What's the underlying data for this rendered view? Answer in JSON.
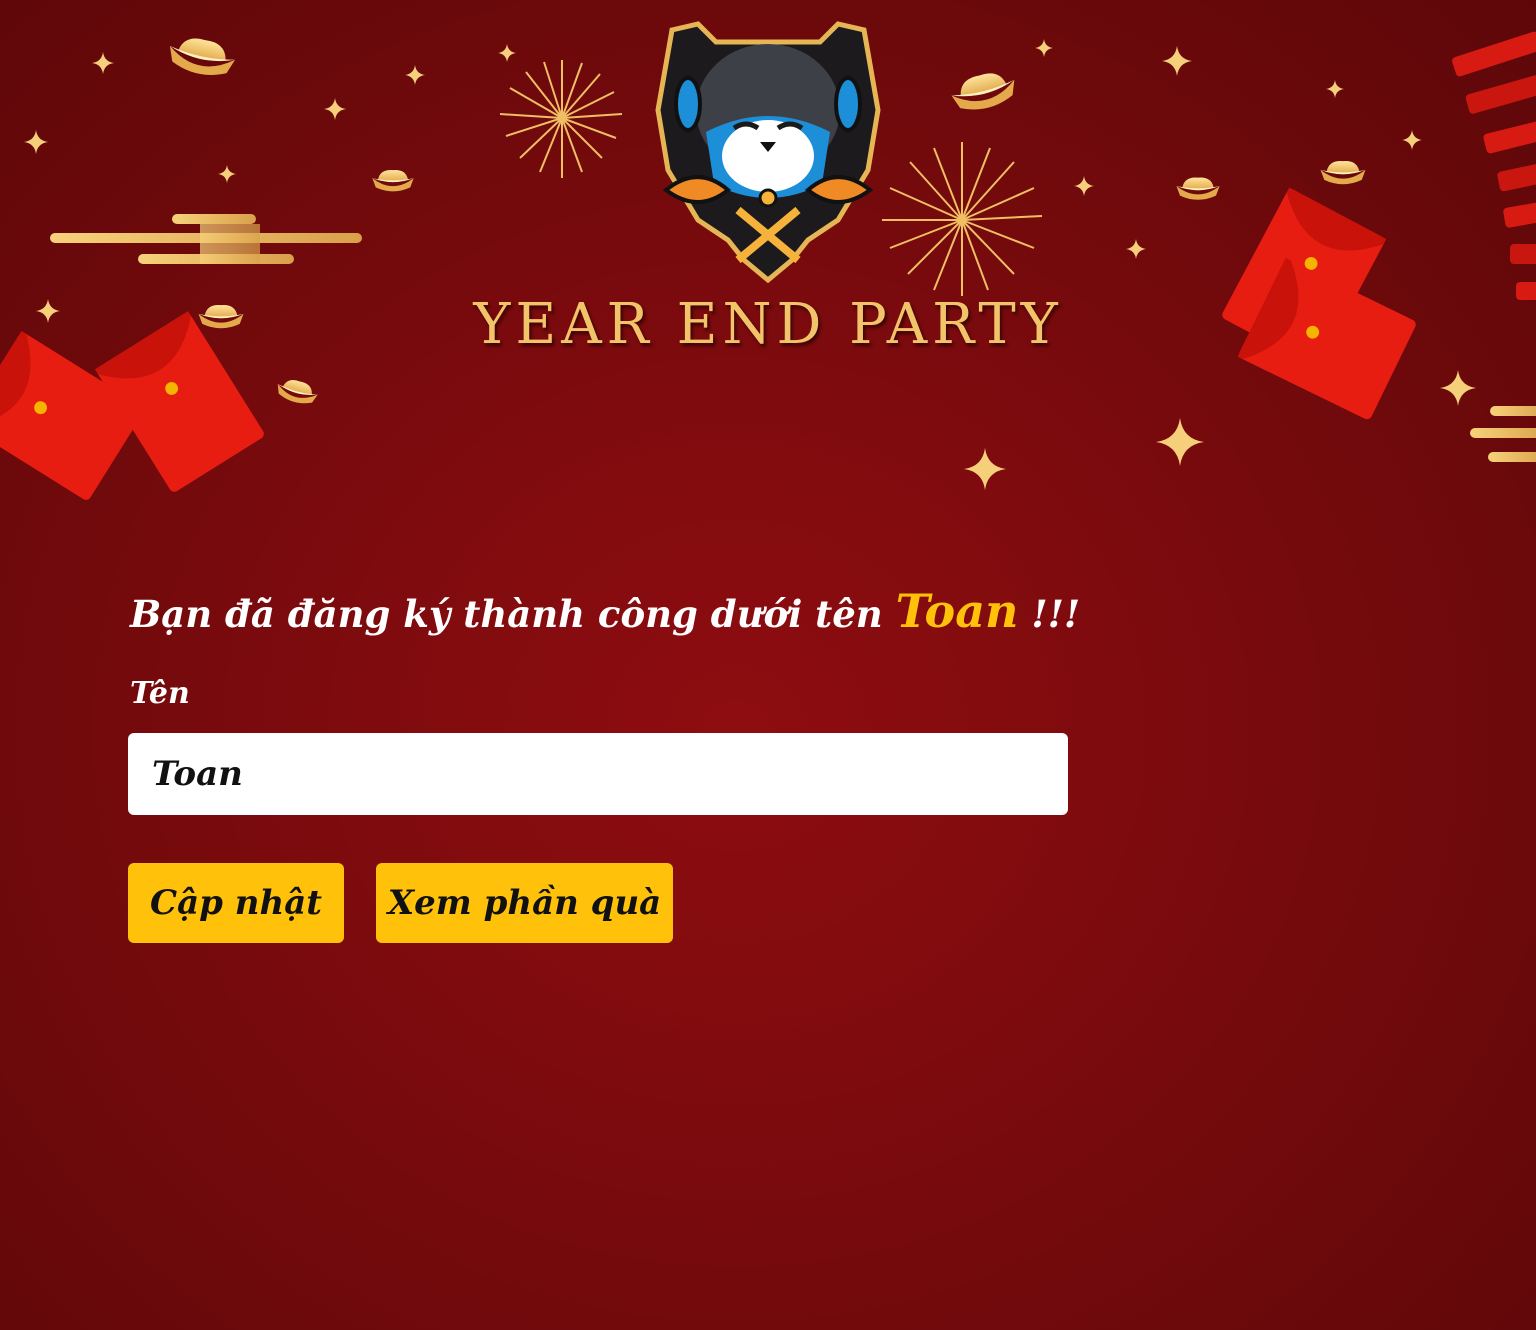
{
  "header": {
    "title": "YEAR END PARTY",
    "logo_icon": "cat-gamer-mascot-logo"
  },
  "decorations": {
    "icons": [
      "gold-ingot-icon",
      "firework-icon",
      "red-envelope-icon",
      "firecracker-icon",
      "sparkle-star-icon",
      "gold-cloud-icon"
    ],
    "colors": {
      "gold": "#f2c46a",
      "envelope": "#e3170f",
      "background": "#7e0b0e"
    }
  },
  "form": {
    "success_prefix": "Bạn đã đăng ký thành công dưới tên",
    "success_name": "Toan",
    "success_suffix": "!!!",
    "name_label": "Tên",
    "name_value": "Toan",
    "update_button": "Cập nhật",
    "gift_button": "Xem phần quà",
    "accent_color": "#ffc10a"
  }
}
